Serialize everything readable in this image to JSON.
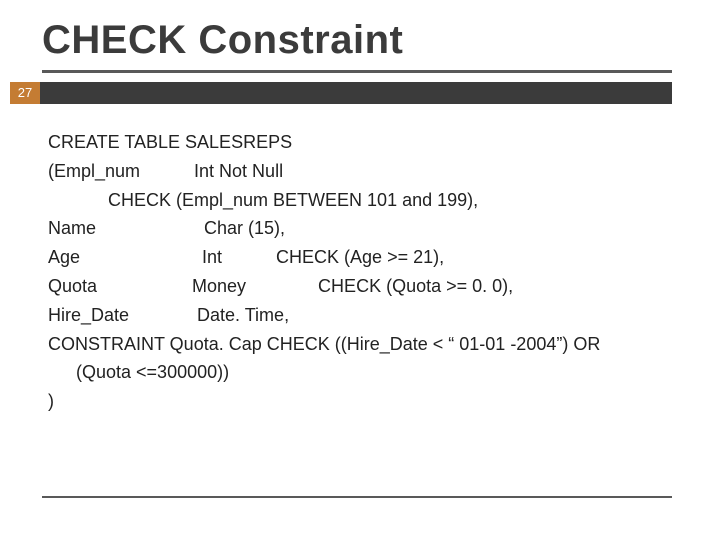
{
  "page_number": "27",
  "title": "CHECK Constraint",
  "code": {
    "l1": "CREATE TABLE SALESREPS",
    "l2": "(Empl_num   Int Not Null",
    "l3": "CHECK (Empl_num BETWEEN 101 and 199),",
    "l4": "Name      Char (15),",
    "l5": "Age         Int   CHECK (Age >= 21),",
    "l6": " Quota       Money    CHECK (Quota >= 0. 0),",
    "l7": "Hire_Date     Date. Time,",
    "l8": "CONSTRAINT  Quota. Cap CHECK ((Hire_Date < “ 01-01 -2004”) OR",
    "l9": "(Quota <=300000))",
    "l10": ")"
  }
}
